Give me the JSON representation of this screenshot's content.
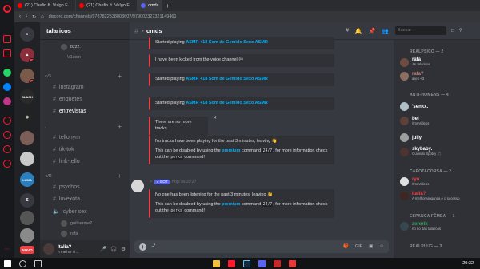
{
  "browser": {
    "tabs": [
      {
        "label": "(21) Chefin ft. Vulgo F…",
        "color": "#ff0000"
      },
      {
        "label": "(21) Chefin ft. Vulgo F…",
        "color": "#ff0000"
      },
      {
        "label": "cmds",
        "color": "#5865f2"
      }
    ],
    "url": "discord.com/channels/978782253880360?/979002327321149461"
  },
  "server": {
    "name": "talaricos"
  },
  "guild_badges": {
    "g1": "4",
    "g2": "1"
  },
  "channels": {
    "voice_top": [
      {
        "name": "bzzz."
      },
      {
        "name": "V1sion"
      }
    ],
    "cat1": "</3",
    "list1": [
      "instagram",
      "enquetes",
      "entrevistas"
    ],
    "cat2": ".",
    "list2": [
      "tellonym",
      "tik-tok",
      "link-tello"
    ],
    "cat3": "</R",
    "list3": [
      "psychos",
      "lovexota",
      "cyber sex"
    ],
    "voice_users": [
      "guilherme?",
      "rafa"
    ]
  },
  "user": {
    "name": "Italia?",
    "status": "A melhor vi…"
  },
  "chat": {
    "channel": "cmds",
    "m1": "Started playing",
    "m1_track": "ASMR +18 Som de Gemido Sexo ASMR",
    "m2": "I have been kicked from the voice channel 😐",
    "m3": "Started playing",
    "m3_track": "ASMR +18 Som de Gemido Sexo ASMR",
    "m4": "Started playing",
    "m4_track": "ASMR +18 Som de Gemido Sexo ASMR",
    "m5": "There are no more tracks",
    "m6a": "No tracks have been playing for the past 3 minutes, leaving 👋",
    "m6b": "This can be disabled by using the",
    "premium": "premium",
    "m6c": "command",
    "code247": "24/7",
    "m6d": ", for more information check out the",
    "code_perks": "perks",
    "m6e": "command!",
    "bot_tag": "BOT",
    "bot_time": "Hoje às 20:27",
    "m7a": "No one has been listening for the past 3 minutes, leaving 👋",
    "composer_text": "-/"
  },
  "search": {
    "placeholder": "Buscar"
  },
  "members": {
    "g1": "REALPSICO — 2",
    "u1": {
      "name": "rafa",
      "status": "🎮 talaricos"
    },
    "u2": {
      "name": "rafa?",
      "status": "alien <3"
    },
    "g2": "ANTI-HOMENS — 4",
    "u3": {
      "name": "'senkx.",
      "status": ""
    },
    "u4": {
      "name": "bel",
      "status": "/tmnVideos"
    },
    "u5": {
      "name": "jully",
      "status": ""
    },
    "u6": {
      "name": "skybaby.",
      "status": "Ouvindo Spotify 🎵"
    },
    "g3": "CAPOTACORSA — 2",
    "u7": {
      "name": "ryo",
      "status": "/tmnVideos"
    },
    "u8": {
      "name": "Italia?",
      "status": "A melhor vingança é o sucesso"
    },
    "g4": "ESPANCA FÊMEA — 1",
    "u9": {
      "name": "zerorik",
      "status": "no rio das talaricos"
    },
    "g5": "REALPLUG — 3"
  },
  "taskbar": {
    "clock": "20:32"
  }
}
